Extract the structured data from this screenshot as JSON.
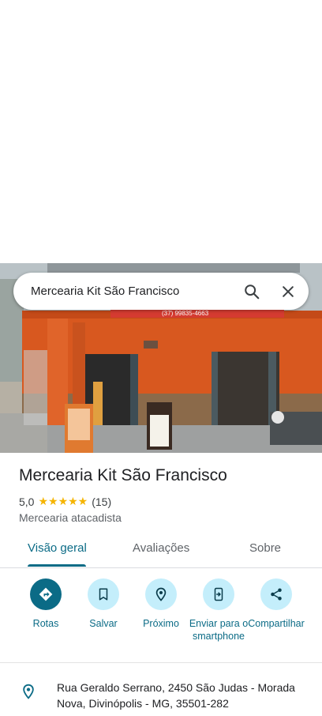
{
  "search": {
    "query": "Mercearia Kit São Francisco"
  },
  "place": {
    "name": "Mercearia Kit São Francisco",
    "rating": "5,0",
    "stars": "★★★★★",
    "review_count": "(15)",
    "category": "Mercearia atacadista",
    "sign_phone": "(37) 99835-4663"
  },
  "tabs": [
    {
      "label": "Visão geral",
      "active": true
    },
    {
      "label": "Avaliações",
      "active": false
    },
    {
      "label": "Sobre",
      "active": false
    }
  ],
  "actions": [
    {
      "label": "Rotas",
      "icon": "directions-icon"
    },
    {
      "label": "Salvar",
      "icon": "bookmark-icon"
    },
    {
      "label": "Próximo",
      "icon": "nearby-icon"
    },
    {
      "label": "Enviar para o smartphone",
      "icon": "send-to-phone-icon"
    },
    {
      "label": "Compartilhar",
      "icon": "share-icon"
    }
  ],
  "address": "Rua Geraldo Serrano, 2450 São Judas - Morada Nova, Divinópolis - MG, 35501-282",
  "colors": {
    "accent": "#0b6b86",
    "action_bg": "#c4eefb",
    "star": "#f5b400",
    "storefront": "#d8581f"
  }
}
